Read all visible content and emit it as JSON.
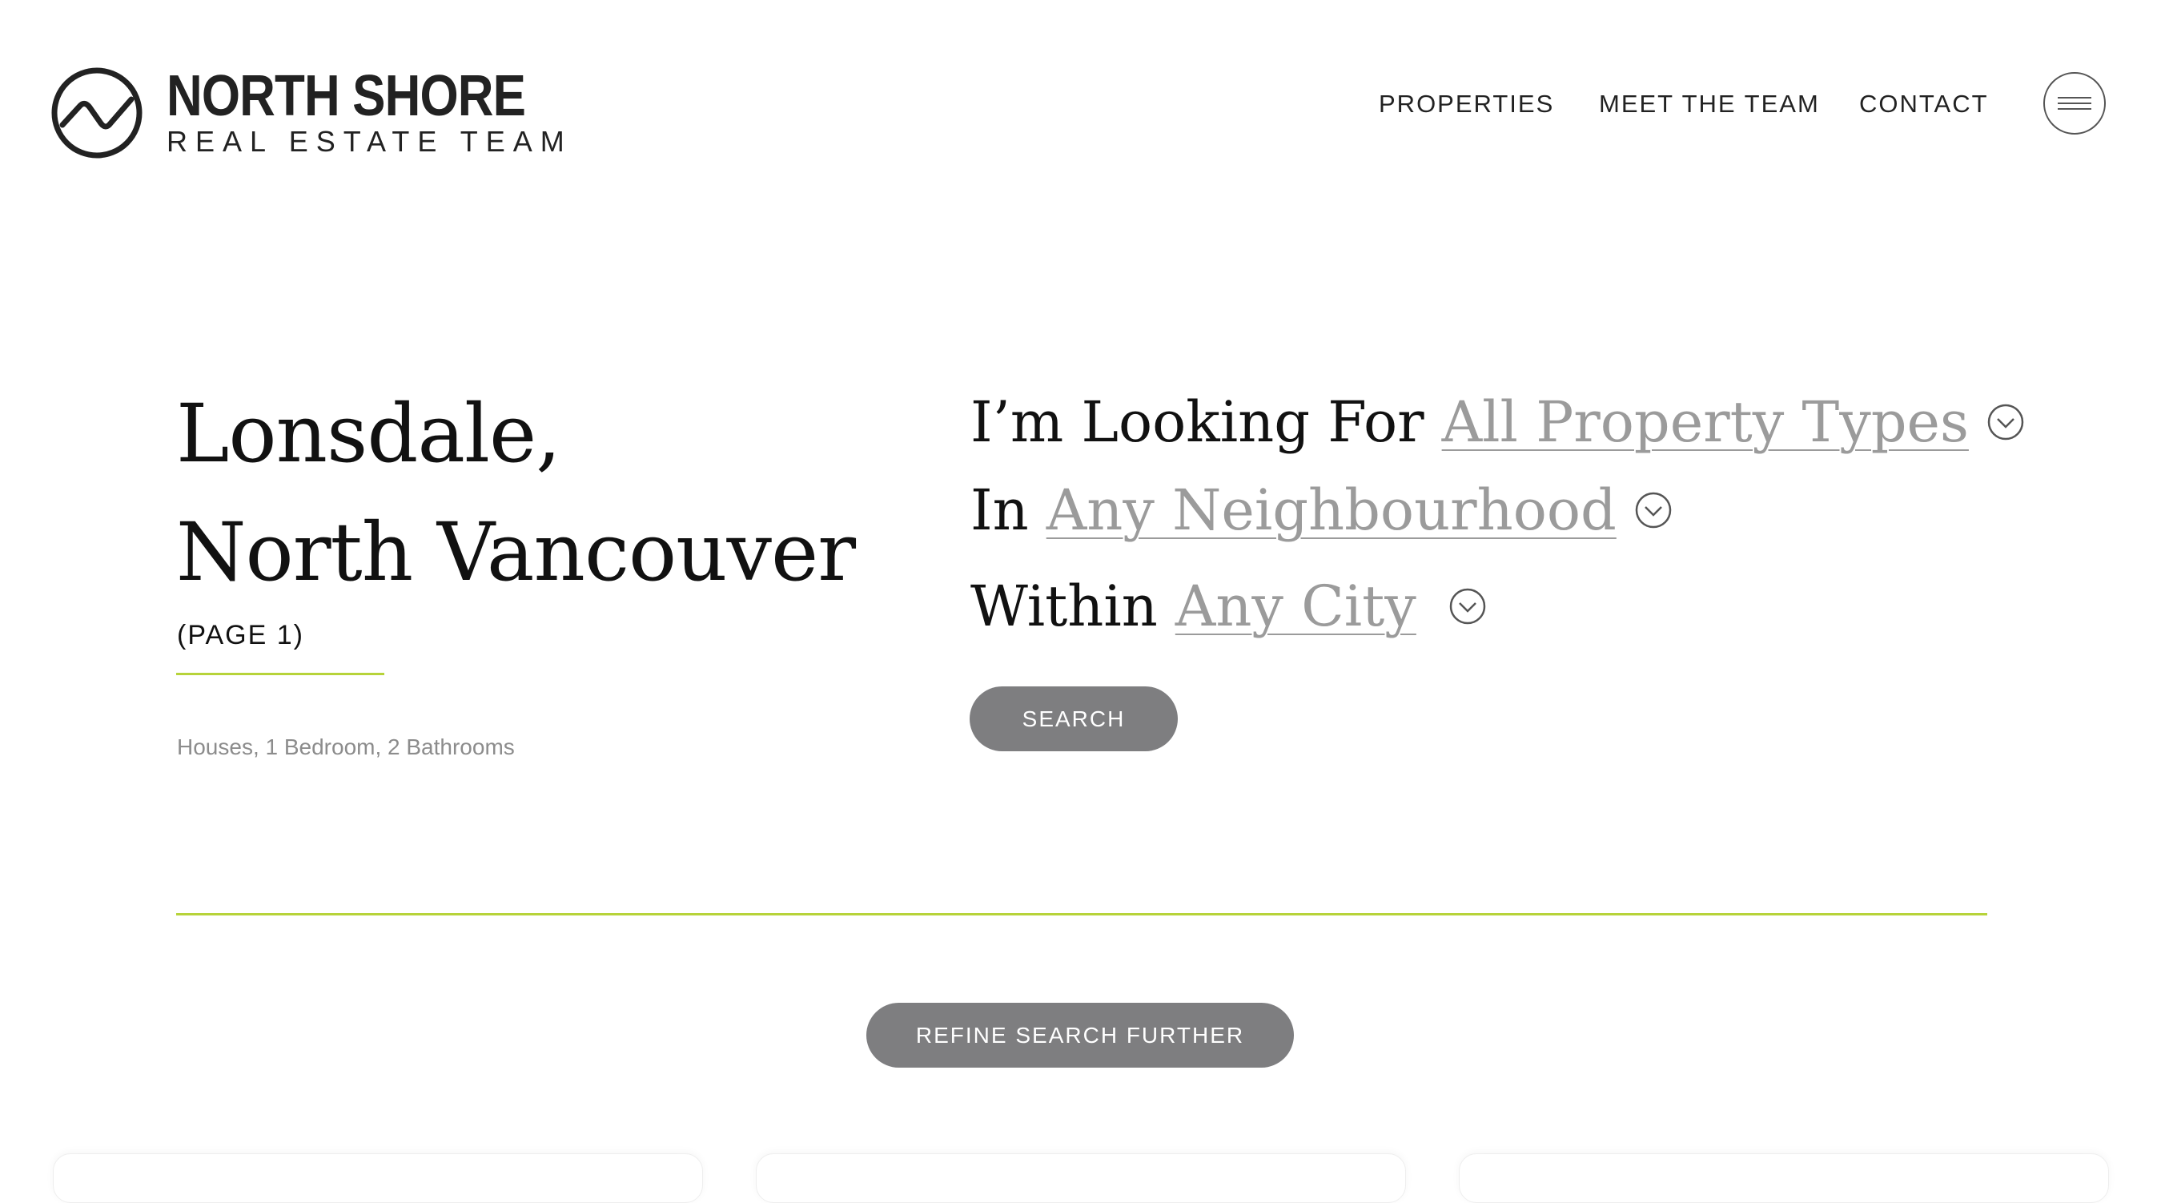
{
  "brand": {
    "title": "NORTH SHORE",
    "subtitle": "REAL ESTATE TEAM",
    "logo_icon": "mountain-wave-logo-icon"
  },
  "nav": {
    "properties": "PROPERTIES",
    "team": "MEET THE TEAM",
    "contact": "CONTACT",
    "menu_icon": "hamburger-menu-icon"
  },
  "hero": {
    "title_line1": "Lonsdale,",
    "title_line2": "North Vancouver",
    "page_label": "(PAGE 1)",
    "filters": "Houses, 1 Bedroom, 2 Bathrooms"
  },
  "search": {
    "line1_prefix": "I’m Looking For",
    "property_type": "All Property Types",
    "line2_prefix": "In",
    "neighbourhood": "Any Neighbourhood",
    "line3_prefix": "Within",
    "city": "Any City",
    "button": "SEARCH"
  },
  "refine_button": "REFINE SEARCH FURTHER",
  "colors": {
    "accent": "#b7d33a",
    "button": "#7e7e80",
    "muted": "#9b9b9b"
  }
}
